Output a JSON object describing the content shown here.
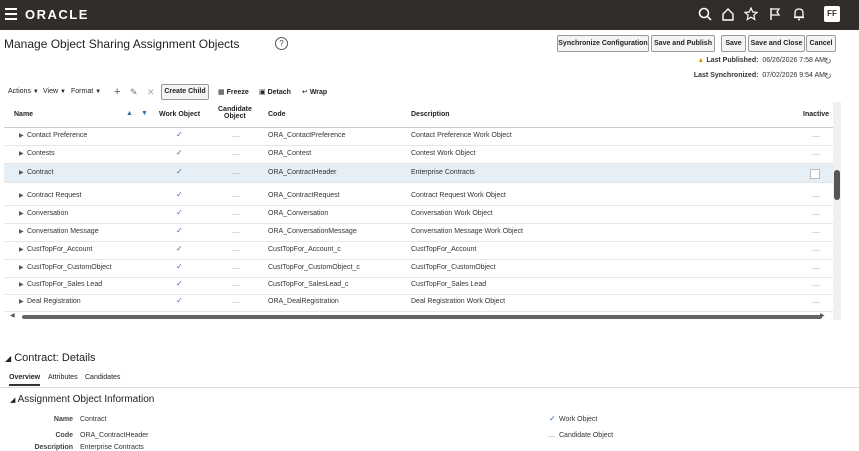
{
  "header": {
    "logo": "ORACLE",
    "avatar": "FF"
  },
  "page": {
    "title": "Manage Object Sharing Assignment Objects"
  },
  "buttons": {
    "sync": "Synchronize Configuration",
    "save_publish": "Save and Publish",
    "save": "Save",
    "save_close": "Save and Close",
    "cancel": "Cancel"
  },
  "status": {
    "last_published_label": "Last Published:",
    "last_published_value": "06/26/2026 7:58 AM",
    "last_sync_label": "Last Synchronized:",
    "last_sync_value": "07/02/2026 9:54 AM"
  },
  "toolbar": {
    "actions": "Actions",
    "view": "View",
    "format": "Format",
    "create_child": "Create Child",
    "freeze": "Freeze",
    "detach": "Detach",
    "wrap": "Wrap"
  },
  "table": {
    "headers": {
      "name": "Name",
      "work_object": "Work Object",
      "candidate_line1": "Candidate",
      "candidate_line2": "Object",
      "code": "Code",
      "description": "Description",
      "inactive": "Inactive"
    },
    "rows": [
      {
        "name": "Contact Preference",
        "code": "ORA_ContactPreference",
        "description": "Contact Preference Work Object",
        "candidate": "....",
        "inactive": "...."
      },
      {
        "name": "Contests",
        "code": "ORA_Contest",
        "description": "Contest Work Object",
        "candidate": "....",
        "inactive": "...."
      },
      {
        "name": "Contract",
        "code": "ORA_ContractHeader",
        "description": "Enterprise Contracts",
        "candidate": "....",
        "inactive": ""
      },
      {
        "name": "Contract Request",
        "code": "ORA_ContractRequest",
        "description": "Contract Request Work Object",
        "candidate": "....",
        "inactive": "...."
      },
      {
        "name": "Conversation",
        "code": "ORA_Conversation",
        "description": "Conversation Work Object",
        "candidate": "....",
        "inactive": "...."
      },
      {
        "name": "Conversation Message",
        "code": "ORA_ConversationMessage",
        "description": "Conversation Message Work Object",
        "candidate": "....",
        "inactive": "...."
      },
      {
        "name": "CustTopFor_Account",
        "code": "CustTopFor_Account_c",
        "description": "CustTopFor_Account",
        "candidate": "....",
        "inactive": "...."
      },
      {
        "name": "CustTopFor_CustomObject",
        "code": "CustTopFor_CustomObject_c",
        "description": "CustTopFor_CustomObject",
        "candidate": "....",
        "inactive": "...."
      },
      {
        "name": "CustTopFor_Sales Lead",
        "code": "CustTopFor_SalesLead_c",
        "description": "CustTopFor_Sales Lead",
        "candidate": "....",
        "inactive": "...."
      },
      {
        "name": "Deal Registration",
        "code": "ORA_DealRegistration",
        "description": "Deal Registration Work Object",
        "candidate": "....",
        "inactive": "...."
      }
    ]
  },
  "details": {
    "title": "Contract: Details",
    "tabs": [
      "Overview",
      "Attributes",
      "Candidates"
    ],
    "section_title": "Assignment Object Information",
    "name_label": "Name",
    "name_value": "Contract",
    "code_label": "Code",
    "code_value": "ORA_ContractHeader",
    "desc_label": "Description",
    "desc_value": "Enterprise Contracts",
    "work_object_label": "Work Object",
    "candidate_label": "Candidate Object",
    "candidate_marker": "...."
  }
}
